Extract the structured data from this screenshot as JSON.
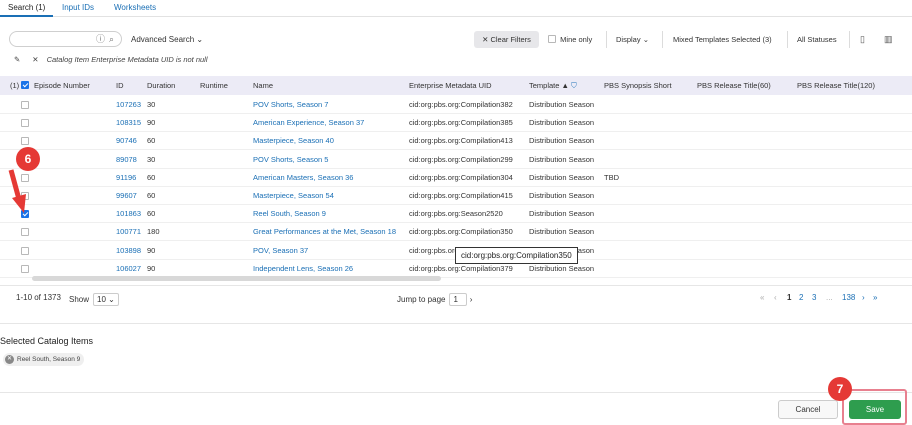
{
  "tabs": [
    {
      "label": "Search (1)",
      "active": true
    },
    {
      "label": "Input IDs",
      "active": false
    },
    {
      "label": "Worksheets",
      "active": false
    }
  ],
  "toolbar": {
    "search_placeholder": "",
    "advanced_search": "Advanced Search",
    "clear_filters": "Clear Filters",
    "mine_only": "Mine only",
    "display": "Display",
    "mixed_templates": "Mixed Templates Selected (3)",
    "all_statuses": "All Statuses"
  },
  "filter": {
    "text": "Catalog Item Enterprise Metadata UID is not null"
  },
  "columns": {
    "count": "(1)",
    "episode_number": "Episode Number",
    "id": "ID",
    "duration": "Duration",
    "runtime": "Runtime",
    "name": "Name",
    "uid": "Enterprise Metadata UID",
    "template": "Template",
    "synopsis": "PBS Synopsis Short",
    "release60": "PBS Release Title(60)",
    "release120": "PBS Release Title(120)"
  },
  "rows": [
    {
      "id": "107263",
      "duration": "30",
      "name": "POV Shorts, Season 7",
      "uid": "cid:org:pbs.org:Compilation382",
      "template": "Distribution Season",
      "synopsis": "",
      "checked": false
    },
    {
      "id": "108315",
      "duration": "90",
      "name": "American Experience, Season 37",
      "uid": "cid:org:pbs.org:Compilation385",
      "template": "Distribution Season",
      "synopsis": "",
      "checked": false
    },
    {
      "id": "90746",
      "duration": "60",
      "name": "Masterpiece, Season 40",
      "uid": "cid:org:pbs.org:Compilation413",
      "template": "Distribution Season",
      "synopsis": "",
      "checked": false
    },
    {
      "id": "89078",
      "duration": "30",
      "name": "POV Shorts, Season 5",
      "uid": "cid:org:pbs.org:Compilation299",
      "template": "Distribution Season",
      "synopsis": "",
      "checked": false
    },
    {
      "id": "91196",
      "duration": "60",
      "name": "American Masters, Season 36",
      "uid": "cid:org:pbs.org:Compilation304",
      "template": "Distribution Season",
      "synopsis": "TBD",
      "checked": false
    },
    {
      "id": "99607",
      "duration": "60",
      "name": "Masterpiece, Season 54",
      "uid": "cid:org:pbs.org:Compilation415",
      "template": "Distribution Season",
      "synopsis": "",
      "checked": false
    },
    {
      "id": "101863",
      "duration": "60",
      "name": "Reel South, Season 9",
      "uid": "cid:org:pbs.org:Season2520",
      "template": "Distribution Season",
      "synopsis": "",
      "checked": true
    },
    {
      "id": "100771",
      "duration": "180",
      "name": "Great Performances at the Met, Season 18",
      "uid": "cid:org:pbs.org:Compilation350",
      "template": "Distribution Season",
      "synopsis": "",
      "checked": false
    },
    {
      "id": "103898",
      "duration": "90",
      "name": "POV, Season 37",
      "uid": "cid:org:pbs.org:Compilation",
      "template": "Distribution Season",
      "synopsis": "",
      "checked": false
    },
    {
      "id": "106027",
      "duration": "90",
      "name": "Independent Lens, Season 26",
      "uid": "cid:org:pbs.org:Compilation379",
      "template": "Distribution Season",
      "synopsis": "",
      "checked": false
    }
  ],
  "tooltip": "cid:org:pbs.org:Compilation350",
  "pager": {
    "range": "1-10 of 1373",
    "show_label": "Show",
    "show_value": "10",
    "jump_label": "Jump to page",
    "jump_value": "1",
    "pages": [
      "1",
      "2",
      "3",
      "...",
      "138"
    ]
  },
  "selected": {
    "title": "Selected Catalog Items",
    "chips": [
      "Reel South, Season 9"
    ]
  },
  "footer": {
    "cancel": "Cancel",
    "save": "Save"
  },
  "annotations": {
    "step6": "6",
    "step7": "7"
  },
  "colors": {
    "accent": "#1a6fb5",
    "save": "#2e9d4e",
    "annotation": "#e53935"
  }
}
